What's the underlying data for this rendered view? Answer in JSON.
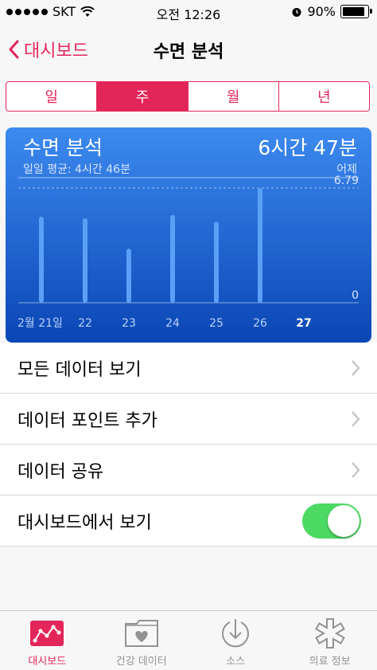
{
  "status_bar": {
    "carrier": "SKT",
    "time": "오전 12:26",
    "battery": "90%"
  },
  "nav": {
    "back_label": "대시보드",
    "title": "수면 분석"
  },
  "segments": [
    {
      "label": "일",
      "active": false
    },
    {
      "label": "주",
      "active": true
    },
    {
      "label": "월",
      "active": false
    },
    {
      "label": "년",
      "active": false
    }
  ],
  "card": {
    "title": "수면 분석",
    "subtitle": "일일 평균: 4시간 46분",
    "value": "6시간 47분",
    "date_label": "어제",
    "max_label": "6.79",
    "min_label": "0"
  },
  "chart_data": {
    "type": "bar",
    "categories": [
      "2월 21일",
      "22",
      "23",
      "24",
      "25",
      "26",
      "27"
    ],
    "values": [
      5.1,
      5.0,
      3.2,
      5.2,
      4.8,
      6.79,
      0
    ],
    "ylim": [
      0,
      6.79
    ],
    "highlight_category": "27",
    "average_line": 4.77
  },
  "list": {
    "items": [
      {
        "label": "모든 데이터 보기",
        "accessory": "chevron"
      },
      {
        "label": "데이터 포인트 추가",
        "accessory": "chevron"
      },
      {
        "label": "데이터 공유",
        "accessory": "chevron"
      },
      {
        "label": "대시보드에서 보기",
        "accessory": "toggle",
        "on": true
      }
    ]
  },
  "tabbar": {
    "items": [
      {
        "label": "대시보드",
        "icon": "dashboard-icon",
        "active": true
      },
      {
        "label": "건강 데이터",
        "icon": "health-data-folder-icon",
        "active": false
      },
      {
        "label": "소스",
        "icon": "sources-download-icon",
        "active": false
      },
      {
        "label": "의료 정보",
        "icon": "medical-id-icon",
        "active": false
      }
    ]
  },
  "colors": {
    "accent": "#e3265a",
    "card_top": "#3c8af0",
    "card_bottom": "#0a46b4",
    "toggle_on": "#4cd964"
  }
}
